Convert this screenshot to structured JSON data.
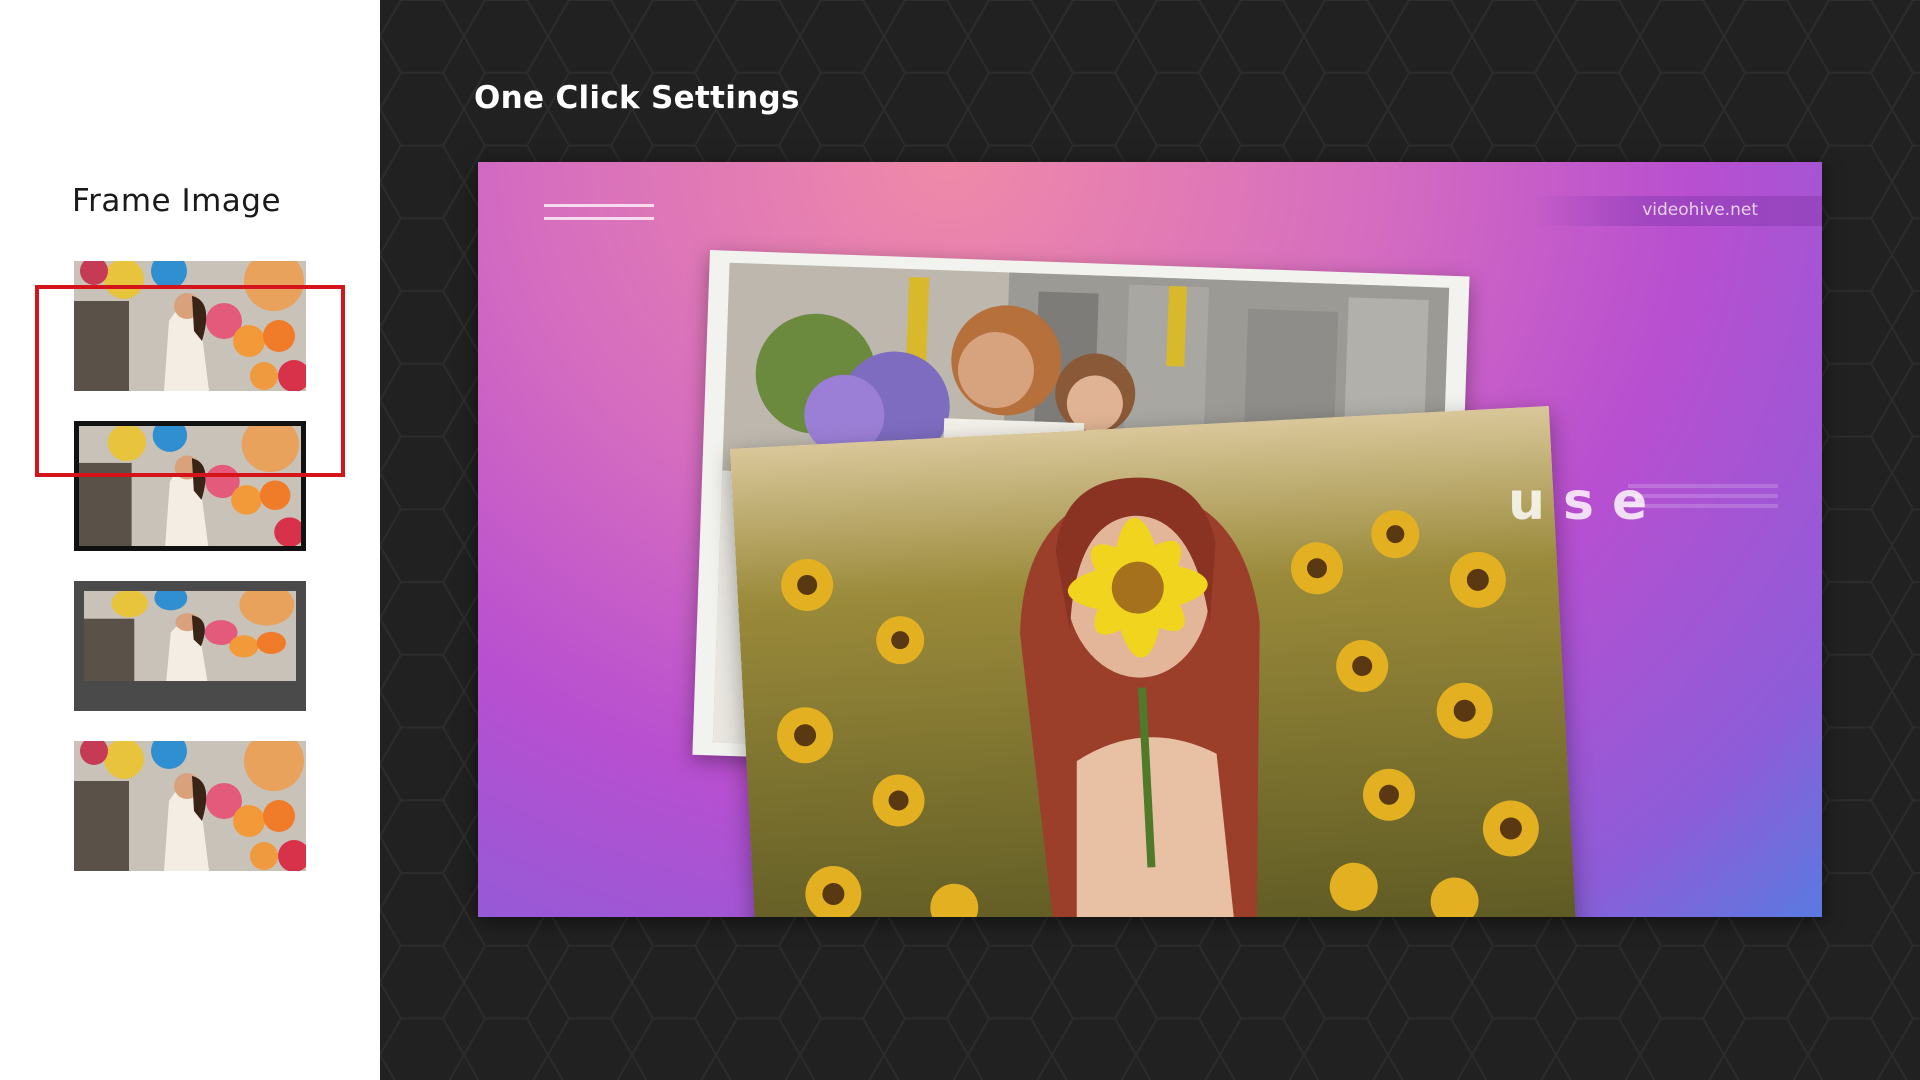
{
  "sidebar": {
    "title": "Frame Image",
    "options": [
      {
        "style": "plain"
      },
      {
        "style": "black-frame"
      },
      {
        "style": "grey-frame"
      },
      {
        "style": "plain"
      }
    ],
    "selected_index": 0
  },
  "main": {
    "title": "One Click Settings",
    "preview": {
      "watermark": "videohive.net",
      "overlay_text": "use"
    }
  },
  "colors": {
    "selection": "#d4131b",
    "background": "#212121",
    "sidebar": "#ffffff"
  }
}
